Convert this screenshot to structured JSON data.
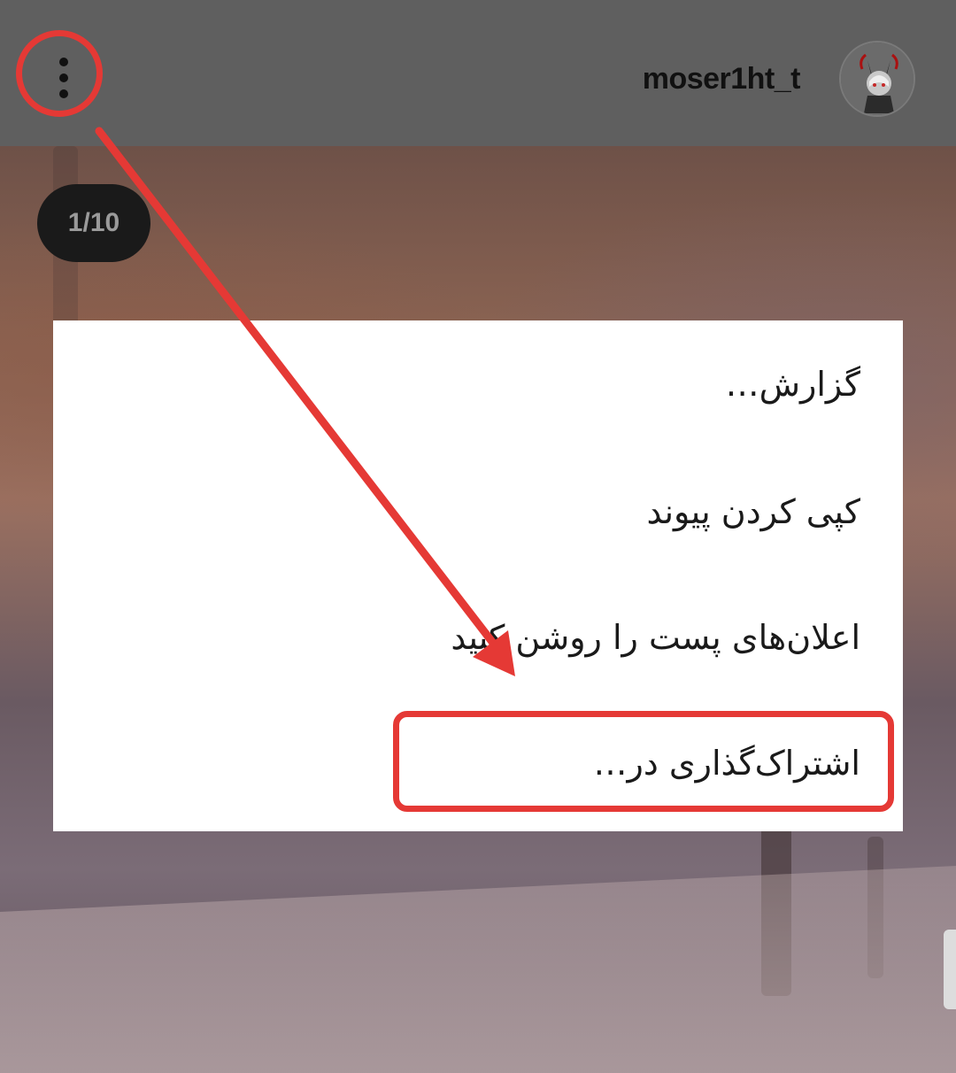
{
  "header": {
    "username": "moser1ht_t",
    "more_icon": "more-vertical-icon",
    "avatar_icon": "avatar-icon"
  },
  "post": {
    "counter": "1/10"
  },
  "menu": {
    "items": [
      {
        "label": "گزارش…"
      },
      {
        "label": "کپی کردن پیوند"
      },
      {
        "label": "اعلان‌های پست را روشن کنید"
      },
      {
        "label": "اشتراک‌گذاری در…"
      }
    ]
  },
  "annotation": {
    "color": "#e53935"
  }
}
